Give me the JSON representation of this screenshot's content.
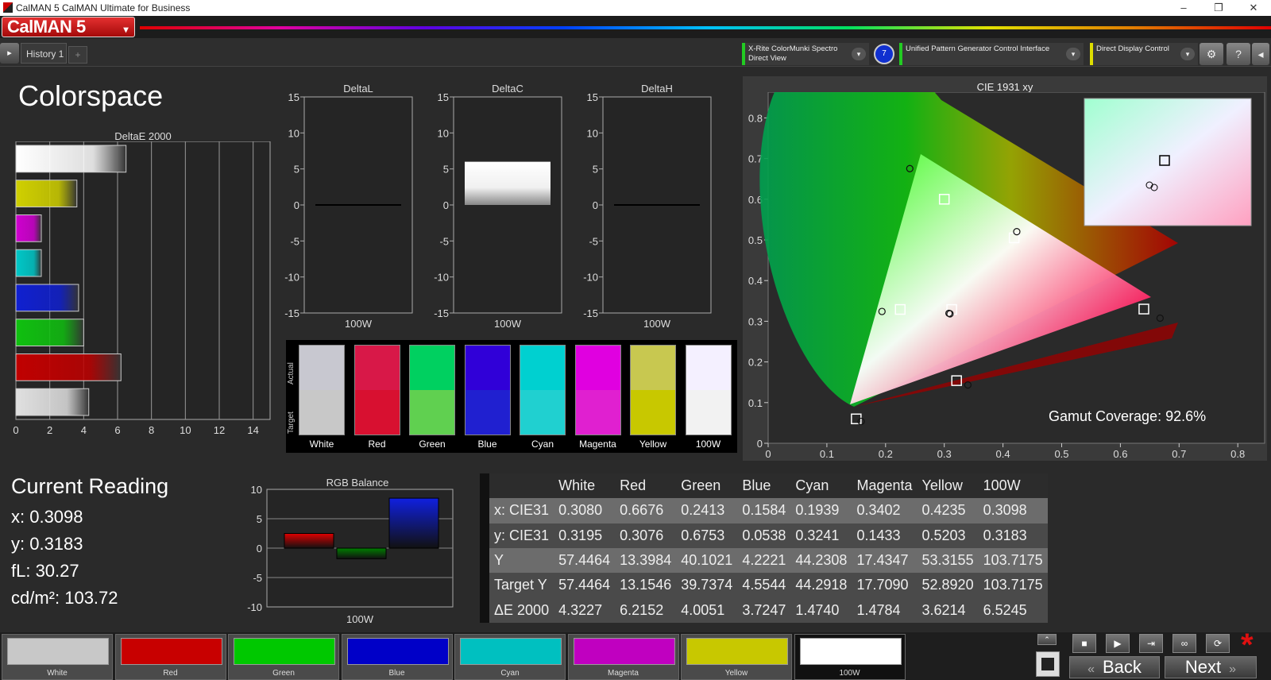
{
  "window": {
    "title": "CalMAN 5 CalMAN Ultimate for Business",
    "minimize": "–",
    "maximize": "❐",
    "close": "✕"
  },
  "brand": {
    "logo": "CalMAN 5",
    "dropdown": "▾"
  },
  "tabs": {
    "history": "History 1",
    "add": "+"
  },
  "devices": [
    {
      "label": "X-Rite ColorMunki Spectro\nDirect View"
    },
    {
      "label": "Unified Pattern Generator Control Interface"
    },
    {
      "label": "Direct Display Control"
    }
  ],
  "device_circle": "7",
  "toolbar": {
    "settings": "⚙",
    "help": "?",
    "collapse": "◂",
    "play": "▸"
  },
  "page_title": "Colorspace",
  "deltaE": {
    "title": "DeltaE 2000",
    "xticks": [
      "0",
      "2",
      "4",
      "6",
      "8",
      "10",
      "12",
      "14"
    ],
    "bars": [
      {
        "name": "White",
        "value": 6.5,
        "color": "#ffffff"
      },
      {
        "name": "Yellow",
        "value": 3.6,
        "color": "#d0d000"
      },
      {
        "name": "Magenta",
        "value": 1.5,
        "color": "#d000d0"
      },
      {
        "name": "Cyan",
        "value": 1.5,
        "color": "#00c8c8"
      },
      {
        "name": "Blue",
        "value": 3.7,
        "color": "#1020d0"
      },
      {
        "name": "Green",
        "value": 4.0,
        "color": "#10c010"
      },
      {
        "name": "Red",
        "value": 6.2,
        "color": "#c00000"
      },
      {
        "name": "100W",
        "value": 4.3,
        "color": "#e0e0e0"
      }
    ]
  },
  "delta_charts": [
    {
      "title": "DeltaL",
      "xlabel": "100W",
      "value": 0
    },
    {
      "title": "DeltaC",
      "xlabel": "100W",
      "value": 6
    },
    {
      "title": "DeltaH",
      "xlabel": "100W",
      "value": 0
    }
  ],
  "delta_yticks": [
    "15",
    "10",
    "5",
    "0",
    "-5",
    "-10",
    "-15"
  ],
  "swatches": {
    "actual_label": "Actual",
    "target_label": "Target",
    "items": [
      {
        "label": "White",
        "actual": "#c8c8d0",
        "target": "#c8c8c8"
      },
      {
        "label": "Red",
        "actual": "#d81848",
        "target": "#d81030"
      },
      {
        "label": "Green",
        "actual": "#00d060",
        "target": "#60d050"
      },
      {
        "label": "Blue",
        "actual": "#3000d8",
        "target": "#2020d0"
      },
      {
        "label": "Cyan",
        "actual": "#00d0d0",
        "target": "#20d0d0"
      },
      {
        "label": "Magenta",
        "actual": "#e000e0",
        "target": "#e020d0"
      },
      {
        "label": "Yellow",
        "actual": "#c8c850",
        "target": "#c8c800"
      },
      {
        "label": "100W",
        "actual": "#f4f0ff",
        "target": "#f2f2f2"
      }
    ]
  },
  "cie": {
    "title": "CIE 1931 xy",
    "gamut_label": "Gamut Coverage:",
    "gamut_value": "92.6%",
    "xticks": [
      "0",
      "0.1",
      "0.2",
      "0.3",
      "0.4",
      "0.5",
      "0.6",
      "0.7",
      "0.8"
    ],
    "yticks": [
      "0.8",
      "0.7",
      "0.6",
      "0.5",
      "0.4",
      "0.3",
      "0.2",
      "0.1",
      "0"
    ]
  },
  "current_reading": {
    "title": "Current Reading",
    "x": "x: 0.3098",
    "y": "y: 0.3183",
    "fL": "fL: 30.27",
    "cdm2": "cd/m²: 103.72"
  },
  "rgb_balance": {
    "title": "RGB Balance",
    "xlabel": "100W",
    "yticks": [
      "10",
      "5",
      "0",
      "-5",
      "-10"
    ],
    "values": [
      {
        "name": "R",
        "value": 2.5,
        "color": "#e00000"
      },
      {
        "name": "G",
        "value": -1.8,
        "color": "#008000"
      },
      {
        "name": "B",
        "value": 8.5,
        "color": "#1020e0"
      }
    ]
  },
  "table": {
    "headers": [
      "",
      "White",
      "Red",
      "Green",
      "Blue",
      "Cyan",
      "Magenta",
      "Yellow",
      "100W"
    ],
    "rows": [
      [
        "x: CIE31",
        "0.3080",
        "0.6676",
        "0.2413",
        "0.1584",
        "0.1939",
        "0.3402",
        "0.4235",
        "0.3098"
      ],
      [
        "y: CIE31",
        "0.3195",
        "0.3076",
        "0.6753",
        "0.0538",
        "0.3241",
        "0.1433",
        "0.5203",
        "0.3183"
      ],
      [
        "Y",
        "57.4464",
        "13.3984",
        "40.1021",
        "4.2221",
        "44.2308",
        "17.4347",
        "53.3155",
        "103.7175"
      ],
      [
        "Target Y",
        "57.4464",
        "13.1546",
        "39.7374",
        "4.5544",
        "44.2918",
        "17.7090",
        "52.8920",
        "103.7175"
      ],
      [
        "ΔE 2000",
        "4.3227",
        "6.2152",
        "4.0051",
        "3.7247",
        "1.4740",
        "1.4784",
        "3.6214",
        "6.5245"
      ]
    ]
  },
  "bottom_swatches": [
    {
      "label": "White",
      "color": "#c8c8c8"
    },
    {
      "label": "Red",
      "color": "#c80000"
    },
    {
      "label": "Green",
      "color": "#00c800"
    },
    {
      "label": "Blue",
      "color": "#0000c8"
    },
    {
      "label": "Cyan",
      "color": "#00c0c0"
    },
    {
      "label": "Magenta",
      "color": "#c000c0"
    },
    {
      "label": "Yellow",
      "color": "#c8c800"
    },
    {
      "label": "100W",
      "color": "#ffffff"
    }
  ],
  "nav": {
    "back": "Back",
    "next": "Next",
    "back_icon": "«",
    "next_icon": "»"
  },
  "asterisk": "*"
}
